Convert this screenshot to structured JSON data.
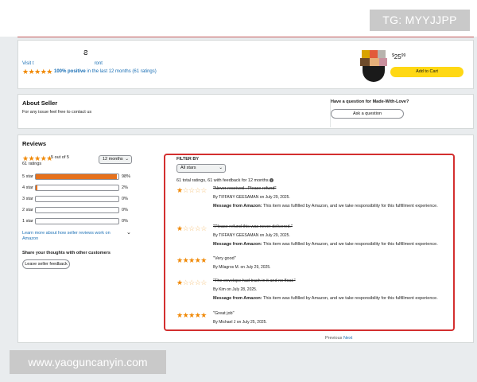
{
  "watermark_top": "TG: MYYJJPP",
  "watermark_bottom": "www.yaoguncanyin.com",
  "header": {
    "visit_prefix": "Visit t",
    "visit_suffix": "ront",
    "seller_mark": "ƨ",
    "positive_text": "100% positive",
    "positive_rest": "in the last 12 months (61 ratings)",
    "price_whole": "25",
    "price_fraction": "99",
    "add_to_cart": "Add to Cart",
    "header_rating": 5
  },
  "about": {
    "title": "About Seller",
    "text": "For any issue feel free to contact us",
    "question_title": "Have a question for Made-With-Love?",
    "ask_button": "Ask a question"
  },
  "reviews": {
    "title": "Reviews",
    "summary_rating": 5,
    "out_of": "5 out of",
    "out_of_value": "5",
    "ratings_count": "61 ratings",
    "period": "12 months",
    "rows": [
      {
        "label": "5 star",
        "percent": "98%",
        "fraction": 0.98
      },
      {
        "label": "4 star",
        "percent": "2%",
        "fraction": 0.02
      },
      {
        "label": "3 star",
        "percent": "0%",
        "fraction": 0
      },
      {
        "label": "2 star",
        "percent": "0%",
        "fraction": 0
      },
      {
        "label": "1 star",
        "percent": "0%",
        "fraction": 0
      }
    ],
    "learn_more": "Learn more about how seller reviews work on Amazon",
    "share_title": "Share your thoughts with other customers",
    "leave_feedback": "Leave seller feedback"
  },
  "filter": {
    "title": "FILTER BY",
    "selected": "All stars",
    "total_text": "61 total ratings, 61 with feedback for 12 months",
    "info_icon": "info-icon"
  },
  "review_items": [
    {
      "rating": 1,
      "text": "Never received . Please refund",
      "strike": true,
      "byline": "By TIFFANY GEESAMAN on July 29, 2025.",
      "response_label": "Message from Amazon:",
      "response_text": "This item was fulfilled by Amazon, and we take responsibility for this fulfillment experience."
    },
    {
      "rating": 1,
      "text": "Please refund this was never delivered.",
      "strike": true,
      "byline": "By TIFFANY GEESAMAN on July 29, 2025.",
      "response_label": "Message from Amazon:",
      "response_text": "This item was fulfilled by Amazon, and we take responsibility for this fulfillment experience."
    },
    {
      "rating": 5,
      "text": "Very good",
      "strike": false,
      "byline": "By Milagros M. on July 29, 2025.",
      "response_label": "",
      "response_text": ""
    },
    {
      "rating": 1,
      "text": "The envelope had trash in it and no float.",
      "strike": true,
      "byline": "By Kim on July 28, 2025.",
      "response_label": "Message from Amazon:",
      "response_text": "This item was fulfilled by Amazon, and we take responsibility for this fulfillment experience."
    },
    {
      "rating": 5,
      "text": "Great job",
      "strike": false,
      "byline": "By Michael J on July 25, 2025.",
      "response_label": "",
      "response_text": ""
    }
  ],
  "pagination": {
    "previous": "Previous",
    "next": "Next"
  },
  "colors": {
    "star": "#f08804",
    "link": "#1a6fb5",
    "cart": "#ffd814",
    "highlight": "#d32f2f",
    "bar_fill": "#e6711b"
  }
}
